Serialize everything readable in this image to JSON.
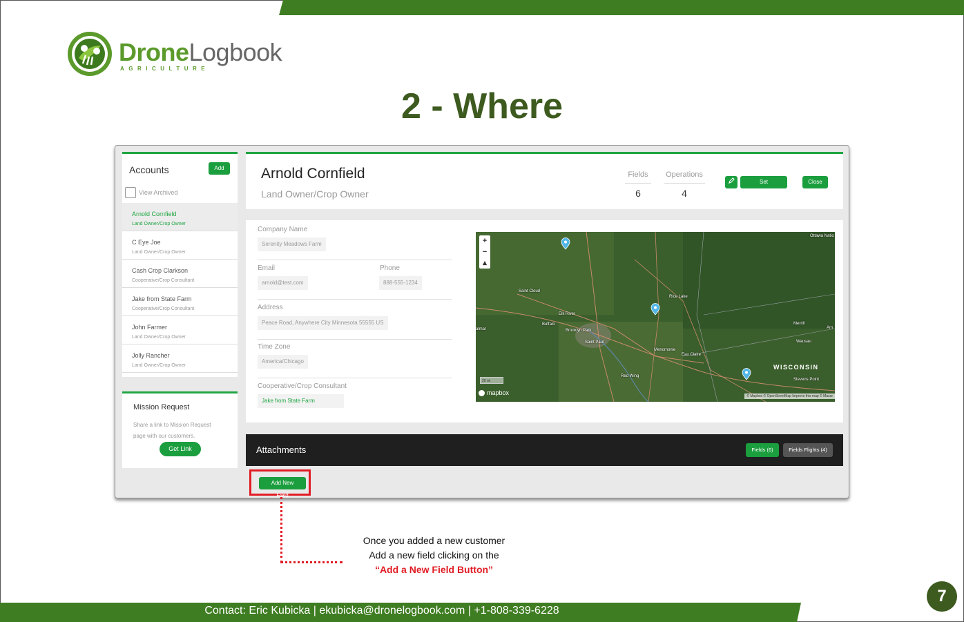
{
  "colors": {
    "brand_green": "#3f7d22",
    "app_green": "#1fa542",
    "highlight_red": "#e11c24",
    "title_green": "#3d5a1f"
  },
  "logo": {
    "word_a": "Drone",
    "word_b": "Logbook",
    "sub": "AGRICULTURE",
    "icon": "drone-leaf-logo-icon"
  },
  "slide_title": "2 - Where",
  "accounts": {
    "title": "Accounts",
    "add_label": "Add",
    "view_archived": "View Archived",
    "items": [
      {
        "name": "Arnold Cornfield",
        "role": "Land Owner/Crop Owner",
        "selected": true
      },
      {
        "name": "C Eye Joe",
        "role": "Land Owner/Crop Owner"
      },
      {
        "name": "Cash Crop Clarkson",
        "role": "Cooperative/Crop Consultant"
      },
      {
        "name": "Jake from State Farm",
        "role": "Cooperative/Crop Consultant"
      },
      {
        "name": "John Farmer",
        "role": "Land Owner/Crop Owner"
      },
      {
        "name": "Jolly Rancher",
        "role": "Land Owner/Crop Owner"
      }
    ]
  },
  "mission_request": {
    "title": "Mission Request",
    "desc": "Share a link to Mission Request page with our customers.",
    "button": "Get Link"
  },
  "customer": {
    "name": "Arnold Cornfield",
    "role": "Land Owner/Crop Owner",
    "stats": [
      {
        "label": "Fields",
        "value": "6"
      },
      {
        "label": "Operations",
        "value": "4"
      }
    ],
    "edit_icon": "pencil-icon",
    "set_consultant": "Set Consultant",
    "close": "Close"
  },
  "details": {
    "company_label": "Company Name",
    "company": "Serenity Meadows Farm",
    "email_label": "Email",
    "email": "arnold@test.com",
    "phone_label": "Phone",
    "phone": "888-555-1234",
    "address_label": "Address",
    "address": "Peace Road, Anywhere City Minnesota 55555 US",
    "timezone_label": "Time Zone",
    "timezone": "America/Chicago",
    "consultant_label": "Cooperative/Crop Consultant",
    "consultant": "Jake from State Farm"
  },
  "map": {
    "zoom_in": "+",
    "zoom_out": "−",
    "compass": "▴",
    "labels": [
      "Saint Cloud",
      "Elk River",
      "Buffalo",
      "Brooklyn Park",
      "Saint Paul",
      "Rice Lake",
      "Menomonie",
      "Eau Claire",
      "Red Wing",
      "Merrill",
      "Wausau",
      "Stevens Point",
      "Ottawa Natio",
      "almar",
      "Am"
    ],
    "state_label": "WISCONSIN",
    "scale": "20 mi",
    "brand": "mapbox",
    "attribution": "© Mapbox © OpenStreetMap  Improve this map © Maxar"
  },
  "attachments": {
    "title": "Attachments",
    "fields_tab": "Fields (6)",
    "flights_tab": "Fields Flights (4)",
    "add_field": "Add New Field"
  },
  "note": {
    "line1": "Once you added a new customer",
    "line2": "Add a new field clicking on the",
    "line3": "“Add a New Field Button”"
  },
  "footer": {
    "contact": "Contact: Eric Kubicka  |  ekubicka@dronelogbook.com  |  +1-808-339-6228",
    "page": "7"
  }
}
